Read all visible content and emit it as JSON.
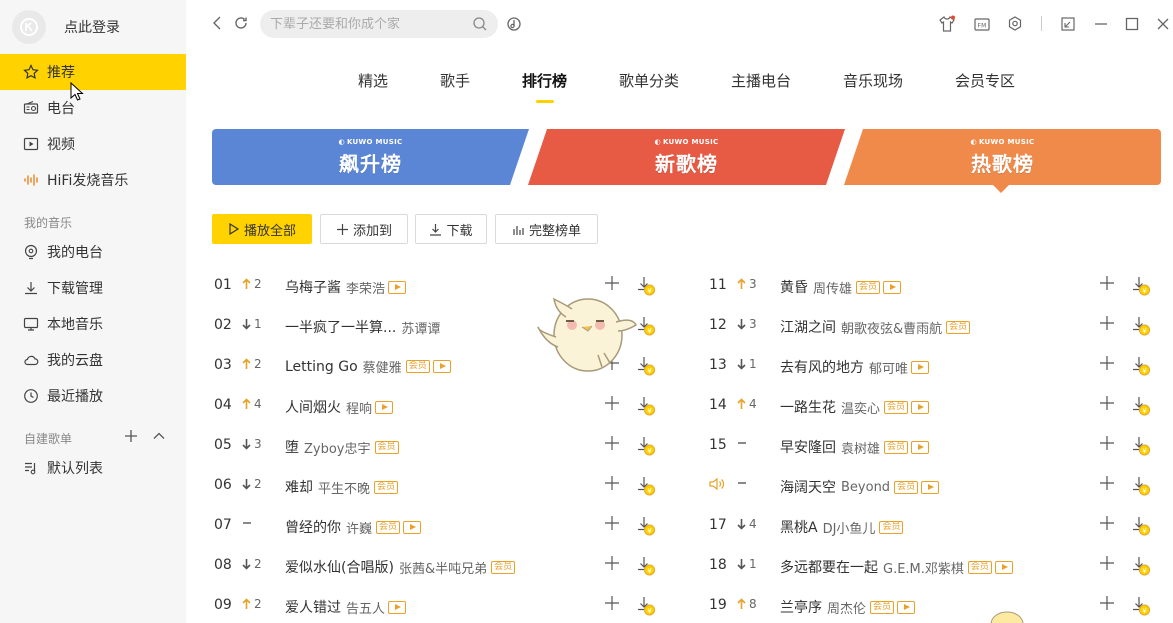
{
  "sidebar": {
    "login_text": "点此登录",
    "main_items": [
      {
        "label": "推荐",
        "icon": "star-icon",
        "active": true
      },
      {
        "label": "电台",
        "icon": "radio-icon"
      },
      {
        "label": "视频",
        "icon": "video-icon"
      },
      {
        "label": "HiFi发烧音乐",
        "icon": "hifi-wave-icon"
      }
    ],
    "my_music_title": "我的音乐",
    "my_music_items": [
      {
        "label": "我的电台",
        "icon": "my-radio-icon"
      },
      {
        "label": "下载管理",
        "icon": "download-icon"
      },
      {
        "label": "本地音乐",
        "icon": "monitor-icon"
      },
      {
        "label": "我的云盘",
        "icon": "cloud-icon"
      },
      {
        "label": "最近播放",
        "icon": "clock-icon"
      }
    ],
    "playlist_title": "自建歌单",
    "playlist_items": [
      {
        "label": "默认列表",
        "icon": "playlist-icon"
      }
    ]
  },
  "search": {
    "placeholder": "下辈子还要和你成个家"
  },
  "tabs": [
    "精选",
    "歌手",
    "排行榜",
    "歌单分类",
    "主播电台",
    "音乐现场",
    "会员专区"
  ],
  "active_tab": "排行榜",
  "banners": [
    {
      "brand": "KUWO MUSIC",
      "title": "飙升榜",
      "color": "#5b86d6"
    },
    {
      "brand": "KUWO MUSIC",
      "title": "新歌榜",
      "color": "#e75b45"
    },
    {
      "brand": "KUWO MUSIC",
      "title": "热歌榜",
      "color": "#f08a4b"
    }
  ],
  "actions": {
    "play_all": "播放全部",
    "add_to": "添加到",
    "download": "下载",
    "full_list": "完整榜单"
  },
  "colors": {
    "accent": "#ffd200",
    "up": "#e9a12a",
    "down": "#555555",
    "vip": "#e9a12a"
  },
  "songs_left": [
    {
      "rank": "01",
      "trend": "up",
      "change": "2",
      "title": "乌梅子酱",
      "artist": "李荣浩",
      "vip": false,
      "mv": true
    },
    {
      "rank": "02",
      "trend": "down",
      "change": "1",
      "title": "一半疯了一半算...",
      "artist": "苏谭谭",
      "vip": false,
      "mv": false
    },
    {
      "rank": "03",
      "trend": "up",
      "change": "2",
      "title": "Letting Go",
      "artist": "蔡健雅",
      "vip": true,
      "mv": true
    },
    {
      "rank": "04",
      "trend": "up",
      "change": "4",
      "title": "人间烟火",
      "artist": "程响",
      "vip": false,
      "mv": true
    },
    {
      "rank": "05",
      "trend": "down",
      "change": "3",
      "title": "堕",
      "artist": "Zyboy忠宇",
      "vip": true,
      "mv": false
    },
    {
      "rank": "06",
      "trend": "down",
      "change": "2",
      "title": "难却",
      "artist": "平生不晚",
      "vip": true,
      "mv": false
    },
    {
      "rank": "07",
      "trend": "same",
      "change": "",
      "title": "曾经的你",
      "artist": "许巍",
      "vip": true,
      "mv": true
    },
    {
      "rank": "08",
      "trend": "down",
      "change": "2",
      "title": "爱似水仙(合唱版)",
      "artist": "张茜&半吨兄弟",
      "vip": true,
      "mv": false
    },
    {
      "rank": "09",
      "trend": "up",
      "change": "2",
      "title": "爱人错过",
      "artist": "告五人",
      "vip": false,
      "mv": true
    }
  ],
  "songs_right": [
    {
      "rank": "11",
      "trend": "up",
      "change": "3",
      "title": "黄昏",
      "artist": "周传雄",
      "vip": true,
      "mv": true
    },
    {
      "rank": "12",
      "trend": "down",
      "change": "3",
      "title": "江湖之间",
      "artist": "朝歌夜弦&曹雨航",
      "vip": true,
      "mv": false
    },
    {
      "rank": "13",
      "trend": "down",
      "change": "1",
      "title": "去有风的地方",
      "artist": "郁可唯",
      "vip": false,
      "mv": true
    },
    {
      "rank": "14",
      "trend": "up",
      "change": "4",
      "title": "一路生花",
      "artist": "温奕心",
      "vip": true,
      "mv": true
    },
    {
      "rank": "15",
      "trend": "same",
      "change": "",
      "title": "早安隆回",
      "artist": "袁树雄",
      "vip": true,
      "mv": true
    },
    {
      "rank": "",
      "trend": "same",
      "change": "",
      "playing": true,
      "title": "海阔天空",
      "artist": "Beyond",
      "vip": true,
      "mv": true
    },
    {
      "rank": "17",
      "trend": "down",
      "change": "4",
      "title": "黑桃A",
      "artist": "DJ小鱼儿",
      "vip": true,
      "mv": false
    },
    {
      "rank": "18",
      "trend": "down",
      "change": "1",
      "title": "多远都要在一起",
      "artist": "G.E.M.邓紫棋",
      "vip": true,
      "mv": true
    },
    {
      "rank": "19",
      "trend": "up",
      "change": "8",
      "title": "兰亭序",
      "artist": "周杰伦",
      "vip": true,
      "mv": true
    }
  ]
}
